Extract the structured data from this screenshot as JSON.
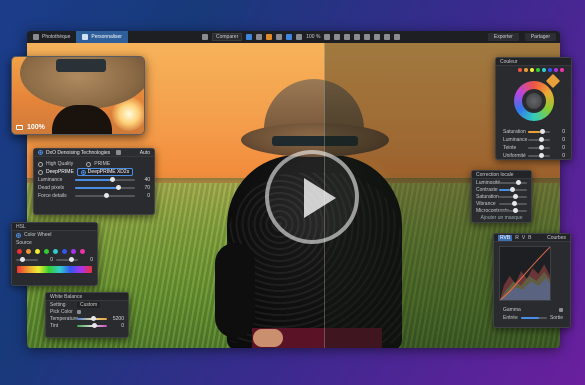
{
  "topbar": {
    "tabs": [
      "Photothèque",
      "Personnaliser"
    ],
    "active_tab": 1,
    "preset": "Comparer",
    "zoom": "100 %",
    "right_buttons": [
      "Exporter",
      "Partager"
    ]
  },
  "thumbnail": {
    "zoom": "100%"
  },
  "dxo": {
    "title": "DxO Denoising Technologies",
    "mode": "Auto",
    "options": [
      "High Quality",
      "PRIME",
      "DeepPRIME",
      "DeepPRIME XD2s"
    ],
    "chip_sub": "XD2s",
    "sliders": [
      {
        "label": "Luminance",
        "value": "40",
        "fraction": 0.4
      },
      {
        "label": "Dead pixels",
        "value": "70",
        "fraction": 0.7
      },
      {
        "label": "Force details",
        "value": "0",
        "fraction": 0.5
      }
    ]
  },
  "color_wheel": {
    "title": "Couleur",
    "sliders": [
      {
        "label": "Saturation",
        "value": "0"
      },
      {
        "label": "Luminance",
        "value": "0"
      },
      {
        "label": "Teinte",
        "value": "0"
      },
      {
        "label": "Uniformité",
        "value": "0"
      }
    ]
  },
  "local_adjust": {
    "title": "Correction locale",
    "rows": [
      "Luminosité",
      "Contraste",
      "Saturation",
      "Vibrance",
      "Microcontraste"
    ],
    "footer": "Ajouter un masque"
  },
  "curves": {
    "title": "Courbes",
    "channels": [
      "RVB",
      "R",
      "V",
      "B"
    ],
    "footer_labels": [
      "Gamma",
      "Entrée",
      "Sortie"
    ]
  },
  "hsl": {
    "title": "HSL",
    "subtitle": "Color Wheel",
    "field": "Source",
    "values": [
      "0",
      "0"
    ]
  },
  "white_balance": {
    "title": "White Balance",
    "preset": "Custom",
    "labels": [
      "Setting",
      "Pick Color",
      "Temperature",
      "Tint"
    ],
    "values": [
      "5200",
      "0"
    ]
  },
  "colors": {
    "accent": "#4a8de4",
    "active_tab": "#2f5f9a"
  }
}
